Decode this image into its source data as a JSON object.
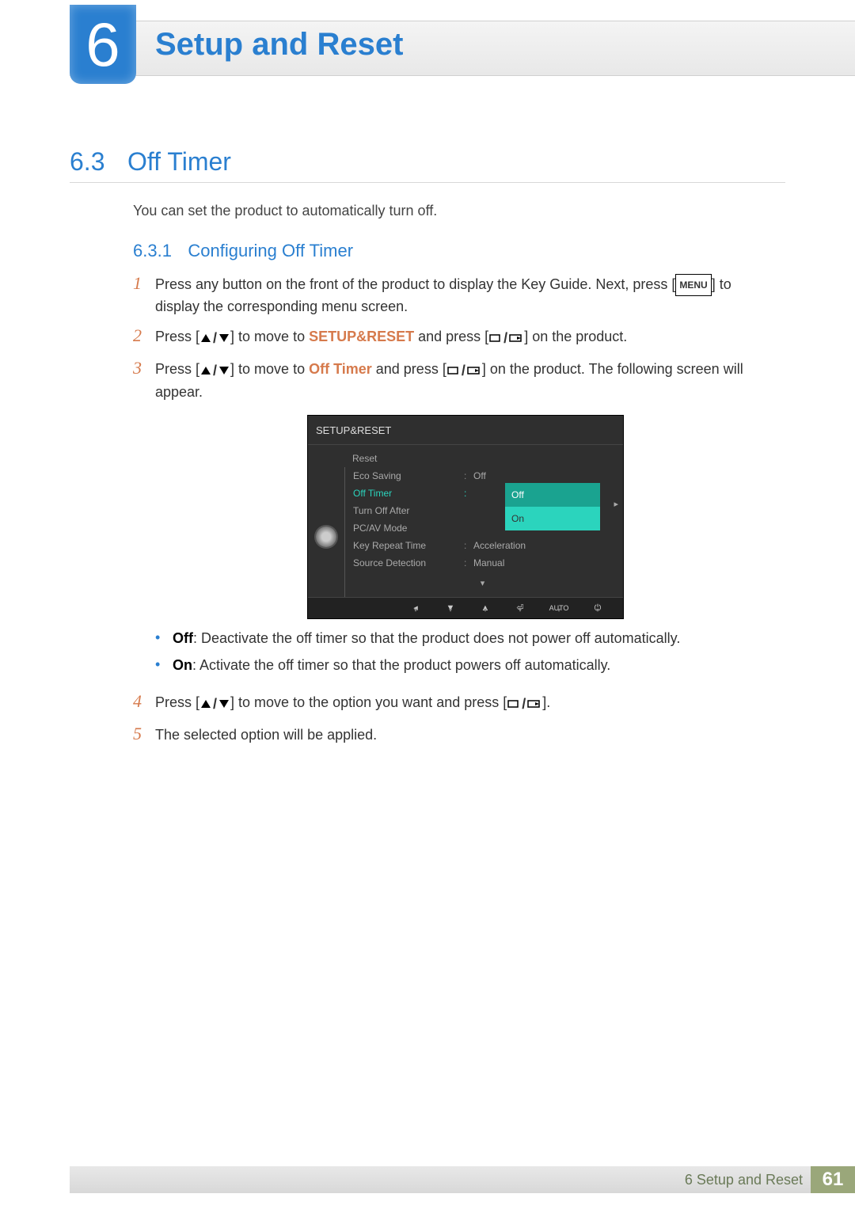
{
  "chapter": {
    "number": "6",
    "title": "Setup and Reset"
  },
  "section": {
    "number": "6.3",
    "title": "Off Timer"
  },
  "intro": "You can set the product to automatically turn off.",
  "subsection": {
    "number": "6.3.1",
    "title": "Configuring Off Timer"
  },
  "steps": {
    "s1": {
      "num": "1",
      "pre": "Press any button on the front of the product to display the Key Guide. Next, press [",
      "menu": "MENU",
      "post": "] to display the corresponding menu screen."
    },
    "s2": {
      "num": "2",
      "pre": "Press [",
      "mid": "] to move to ",
      "kw": "SETUP&RESET",
      "post1": " and press [",
      "post2": "] on the product."
    },
    "s3": {
      "num": "3",
      "pre": "Press [",
      "mid": "] to move to ",
      "kw": "Off Timer",
      "post1": " and press [",
      "post2": "] on the product. The following screen will appear."
    },
    "s4": {
      "num": "4",
      "pre": "Press [",
      "mid": "] to move to the option you want and press [",
      "post": "]."
    },
    "s5": {
      "num": "5",
      "text": "The selected option will be applied."
    }
  },
  "osd": {
    "title": "SETUP&RESET",
    "rows": [
      {
        "label": "Reset",
        "value": ""
      },
      {
        "label": "Eco Saving",
        "value": "Off"
      },
      {
        "label": "Off Timer",
        "value": ""
      },
      {
        "label": "Turn Off After",
        "value": ""
      },
      {
        "label": "PC/AV Mode",
        "value": ""
      },
      {
        "label": "Key Repeat Time",
        "value": "Acceleration"
      },
      {
        "label": "Source Detection",
        "value": "Manual"
      }
    ],
    "dropdown": {
      "opt1": "Off",
      "opt2": "On"
    },
    "controls": {
      "b1": "◂",
      "b2": "▼",
      "b3": "▲",
      "b4": "⏎",
      "b5": "AUTO",
      "b6": "⏻"
    }
  },
  "bullets": {
    "b1": {
      "label": "Off",
      "text": ": Deactivate the off timer so that the product does not power off automatically."
    },
    "b2": {
      "label": "On",
      "text": ": Activate the off timer so that the product powers off automatically."
    }
  },
  "footer": {
    "text": "6 Setup and Reset",
    "page": "61"
  }
}
